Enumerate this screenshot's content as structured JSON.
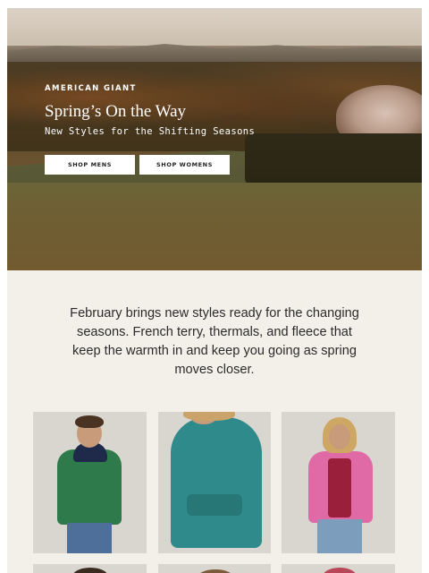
{
  "hero": {
    "brand": "AMERICAN GIANT",
    "headline": "Spring’s On the Way",
    "subhead": "New Styles for the Shifting Seasons",
    "buttons": {
      "mens": "SHOP MENS",
      "womens": "SHOP WOMENS"
    }
  },
  "intro": {
    "text": "February brings new styles ready for the changing seasons. French terry, thermals, and fleece that keep the warmth in and keep you going as spring moves closer."
  },
  "colors": {
    "background": "#f3f0ea",
    "button_bg": "#ffffff",
    "text": "#2b2b2b"
  },
  "products": [
    {
      "name": "green-navy-hoodie",
      "color": "#2f7a4a"
    },
    {
      "name": "teal-pullover-hoodie",
      "color": "#2f8b8b"
    },
    {
      "name": "pink-zip-hoodie",
      "color": "#e06aa6"
    }
  ]
}
